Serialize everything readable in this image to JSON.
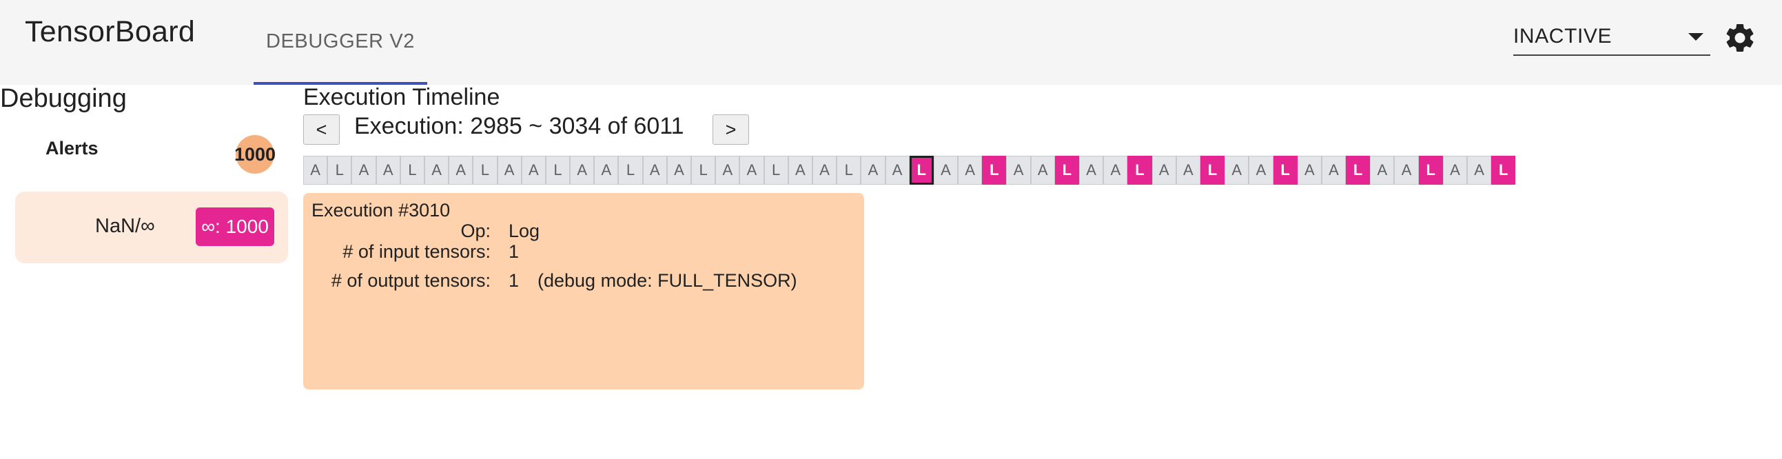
{
  "header": {
    "brand": "TensorBoard",
    "active_plugin": "DEBUGGER V2",
    "data_select": "INACTIVE",
    "settings_icon": "gear-icon"
  },
  "alerts_panel": {
    "title": "Debugging",
    "alerts_label": "Alerts",
    "alerts_count": "1000",
    "alert_types": [
      {
        "name": "NaN/∞",
        "badge": "∞: 1000"
      }
    ]
  },
  "timeline": {
    "title": "Execution Timeline",
    "prev_label": "<",
    "next_label": ">",
    "range_text": "Execution: 2985 ~ 3034 of 6011",
    "cells": [
      "A",
      "L",
      "A",
      "A",
      "L",
      "A",
      "A",
      "L",
      "A",
      "A",
      "L",
      "A",
      "A",
      "L",
      "A",
      "A",
      "L",
      "A",
      "A",
      "L",
      "A",
      "A",
      "L",
      "A",
      "A",
      "L",
      "A",
      "A",
      "L",
      "A",
      "A",
      "L",
      "A",
      "A",
      "L",
      "A",
      "A",
      "L",
      "A",
      "A",
      "L",
      "A",
      "A",
      "L",
      "A",
      "A",
      "L",
      "A",
      "A",
      "L"
    ],
    "alert_cell_indices": [
      25,
      28,
      31,
      34,
      37,
      40,
      43,
      46,
      49
    ],
    "focused_cell_index": 25,
    "colors": {
      "alert": "#e52592",
      "cell": "#e3e5e8",
      "cell_text": "#616161"
    }
  },
  "execution": {
    "title": "Execution #3010",
    "op_label": "Op:",
    "op_value": "Log",
    "inputs_label": "# of input tensors:",
    "inputs_value": "1",
    "outputs_label": "# of output tensors:",
    "outputs_value": "1",
    "debug_mode": "(debug mode: FULL_TENSOR)",
    "card_color": "#fed2ad"
  }
}
